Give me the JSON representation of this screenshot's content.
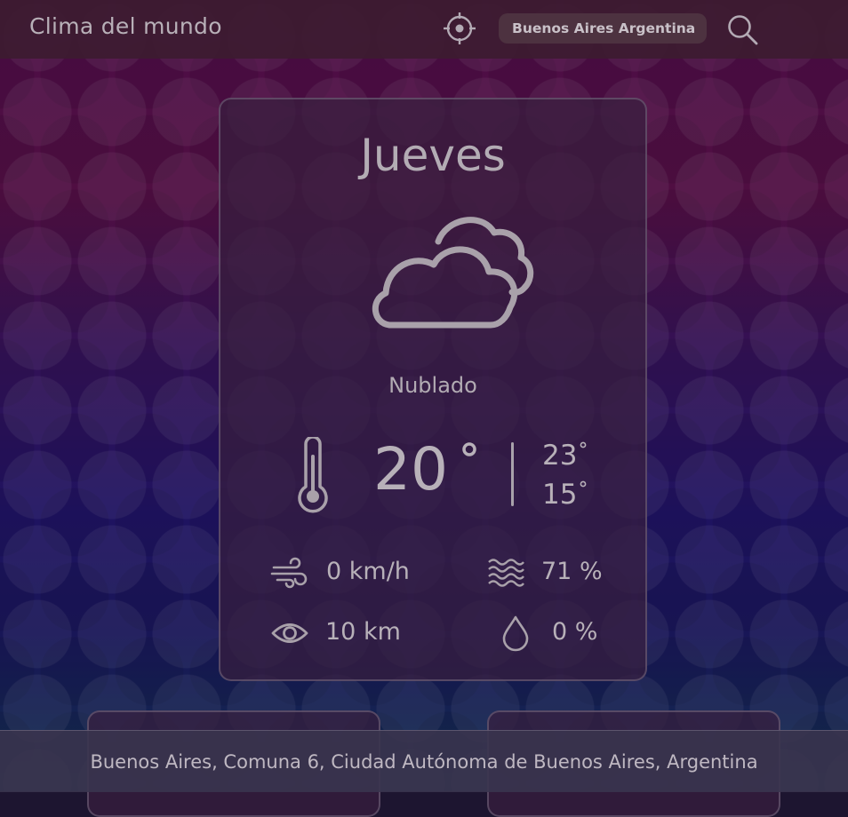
{
  "app": {
    "title": "Clima del mundo"
  },
  "search": {
    "value": "Buenos Aires Argentina"
  },
  "icons": {
    "locate": "crosshair-icon",
    "search": "search-icon",
    "condition": "cloudy-icon",
    "temperature": "thermometer-icon",
    "wind": "wind-icon",
    "humidity": "waves-icon",
    "visibility": "eye-icon",
    "rain": "droplet-icon"
  },
  "forecast": {
    "day": "Jueves",
    "condition": "Nublado",
    "temperature": "20",
    "high": "23",
    "low": "15",
    "wind": "0 km/h",
    "humidity": "71 %",
    "visibility": "10 km",
    "precipitation": "0 %"
  },
  "footer": {
    "location": "Buenos Aires, Comuna 6, Ciudad Autónoma de Buenos Aires, Argentina"
  },
  "colors": {
    "topbar": "#3c1c30",
    "card": "#381e3e",
    "text": "#b8b1b9",
    "input_bg": "#4d3240"
  }
}
